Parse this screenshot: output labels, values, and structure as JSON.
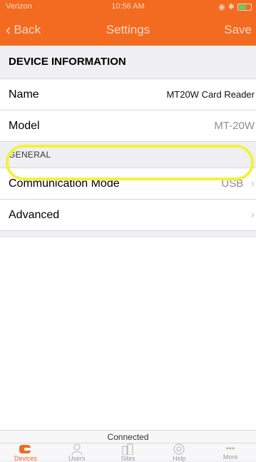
{
  "status_bar": {
    "carrier": "Verizon",
    "time": "10:56 AM"
  },
  "nav": {
    "back_label": "Back",
    "title": "Settings",
    "save_label": "Save"
  },
  "device_information": {
    "header": "DEVICE INFORMATION",
    "name_label": "Name",
    "name_value": "MT20W Card Reader",
    "model_label": "Model",
    "model_value": "MT-20W"
  },
  "general": {
    "header": "GENERAL",
    "communication_label": "Communication Mode",
    "communication_value": "USB",
    "advanced_label": "Advanced"
  },
  "connection_status": "Connected",
  "tabs": [
    {
      "label": "Devices",
      "icon": "devices-icon",
      "active": true
    },
    {
      "label": "Users",
      "icon": "users-icon"
    },
    {
      "label": "Sites",
      "icon": "sites-icon"
    },
    {
      "label": "Help",
      "icon": "help-icon"
    },
    {
      "label": "More",
      "icon": "more-icon"
    }
  ],
  "colors": {
    "accent": "#f26b21",
    "highlight": "#f2f23a"
  }
}
